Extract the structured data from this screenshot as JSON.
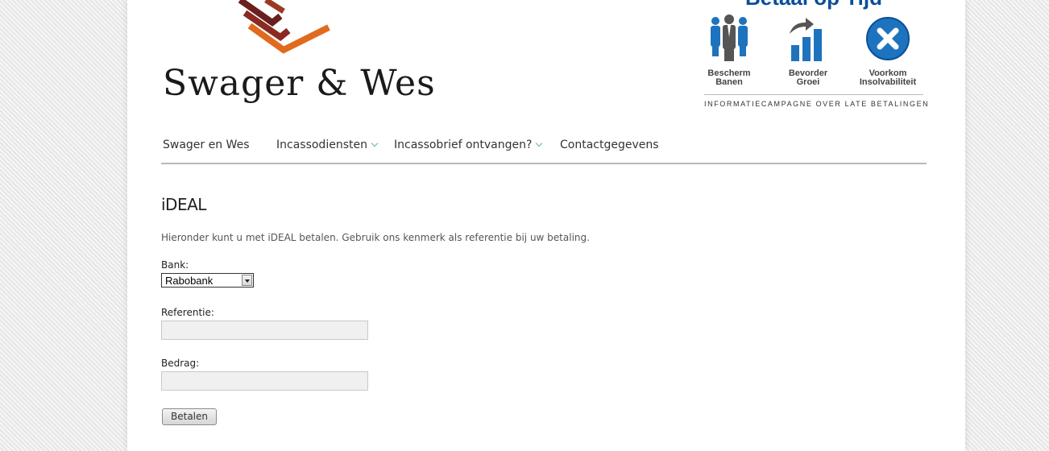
{
  "brand": {
    "name": "Swager & Wes",
    "colors": {
      "dark_red": "#6b1e1e",
      "red": "#9a3a24",
      "orange": "#e06a1e"
    }
  },
  "campaign": {
    "title": "Betaal op Tijd",
    "items": [
      {
        "line1": "Bescherm",
        "line2": "Banen",
        "icon": "people-icon"
      },
      {
        "line1": "Bevorder",
        "line2": "Groei",
        "icon": "growth-chart-icon"
      },
      {
        "line1": "Voorkom",
        "line2": "Insolvabiliteit",
        "icon": "close-circle-icon"
      }
    ],
    "tagline": "INFORMATIECAMPAGNE OVER LATE BETALINGEN",
    "color": "#0a4e9a"
  },
  "nav": {
    "items": [
      {
        "label": "Swager en Wes",
        "has_submenu": false
      },
      {
        "label": "Incassodiensten",
        "has_submenu": true
      },
      {
        "label": "Incassobrief ontvangen?",
        "has_submenu": true
      },
      {
        "label": "Contactgegevens",
        "has_submenu": false
      }
    ]
  },
  "content": {
    "title": "iDEAL",
    "intro": "Hieronder kunt u met iDEAL betalen. Gebruik ons kenmerk als referentie bij uw betaling."
  },
  "form": {
    "bank_label": "Bank:",
    "bank_value": "Rabobank",
    "reference_label": "Referentie:",
    "reference_value": "",
    "amount_label": "Bedrag:",
    "amount_value": "",
    "submit_label": "Betalen"
  }
}
